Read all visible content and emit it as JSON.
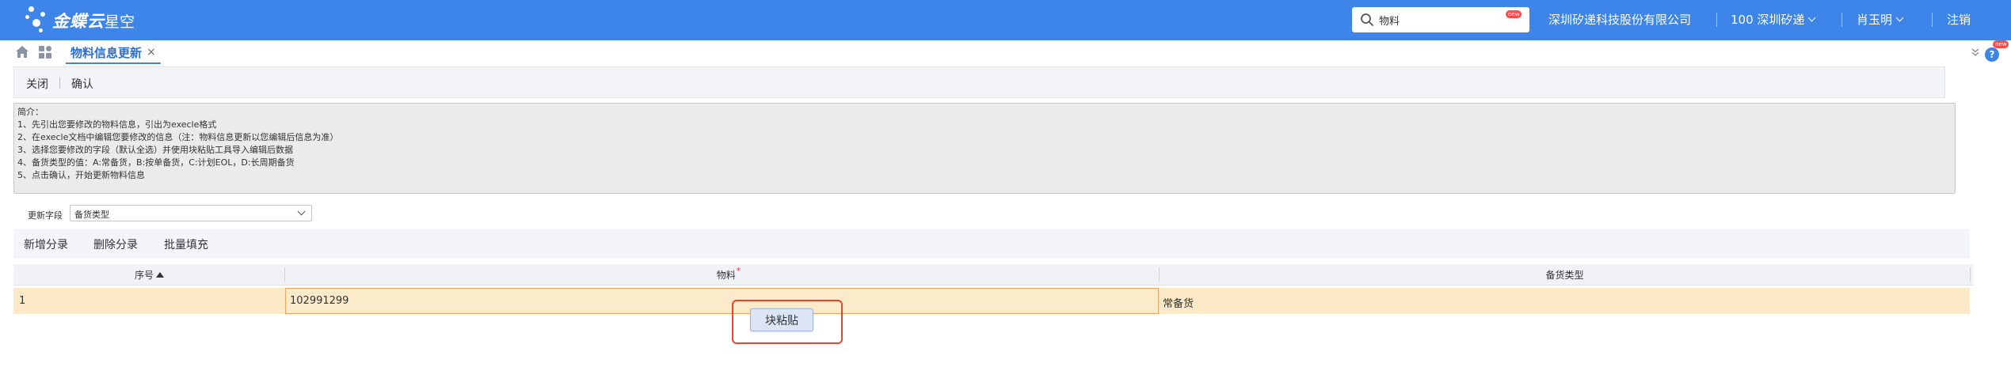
{
  "brand": {
    "name": "金蝶云",
    "product": "星空"
  },
  "search": {
    "value": "物料",
    "badge": "new"
  },
  "header": {
    "company": "深圳矽递科技股份有限公司",
    "org": "100 深圳矽递",
    "user": "肖玉明",
    "logout": "注销"
  },
  "tabs": [
    {
      "label": "物料信息更新",
      "close": "×"
    }
  ],
  "help": {
    "label": "?",
    "badge": "new"
  },
  "toolbar": {
    "close_label": "关闭",
    "confirm_label": "确认"
  },
  "intro": {
    "lines": [
      "简介：",
      "1、先引出您要修改的物料信息，引出为execle格式",
      "2、在execle文档中编辑您要修改的信息（注：物料信息更新以您编辑后信息为准）",
      "3、选择您要修改的字段（默认全选）并使用块粘贴工具导入编辑后数据",
      "4、备货类型的值：A:常备货，B:按单备货，C:计划EOL，D:长周期备货",
      "5、点击确认，开始更新物料信息"
    ]
  },
  "update_field": {
    "label": "更新字段",
    "value": "备货类型"
  },
  "entry_toolbar": {
    "add_label": "新增分录",
    "delete_label": "删除分录",
    "fill_label": "批量填充"
  },
  "grid": {
    "columns": {
      "seq": "序号",
      "material": "物料",
      "required_mark": "*",
      "stock_type": "备货类型"
    },
    "rows": [
      {
        "seq": "1",
        "material": "102991299",
        "stock_type": "常备货"
      }
    ]
  },
  "paste_button": {
    "label": "块粘贴"
  },
  "colors": {
    "topbar": "#3d85e8",
    "row_highlight": "#fbe9c7",
    "focus_border": "#f2a360",
    "annotation_red": "#e8442f"
  }
}
